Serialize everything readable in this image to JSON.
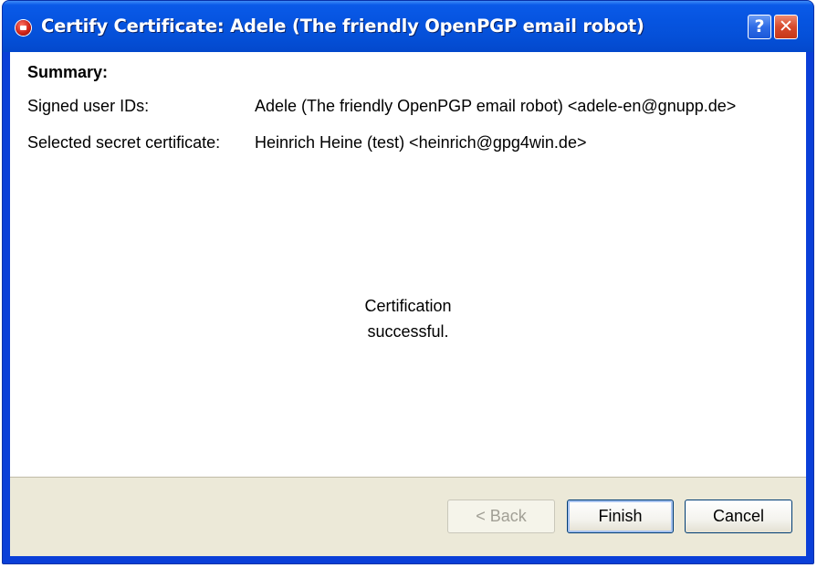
{
  "window": {
    "title": "Certify Certificate: Adele (The friendly OpenPGP email robot)",
    "app_icon": "gpg4win-app-icon",
    "help_label": "?",
    "close_label": "✕"
  },
  "summary": {
    "title": "Summary:",
    "signed_user_ids_label": "Signed user IDs:",
    "signed_user_ids_value": "Adele (The friendly OpenPGP email robot) <adele-en@gnupp.de>",
    "secret_certificate_label": "Selected secret certificate:",
    "secret_certificate_value": "Heinrich Heine (test) <heinrich@gpg4win.de>"
  },
  "status": {
    "line1": "Certification",
    "line2": "successful."
  },
  "buttons": {
    "back_label": "< Back",
    "finish_label": "Finish",
    "cancel_label": "Cancel"
  },
  "colors": {
    "titlebar": "#0654e0",
    "button_bar": "#ece9d8",
    "close_button": "#d7492c"
  }
}
